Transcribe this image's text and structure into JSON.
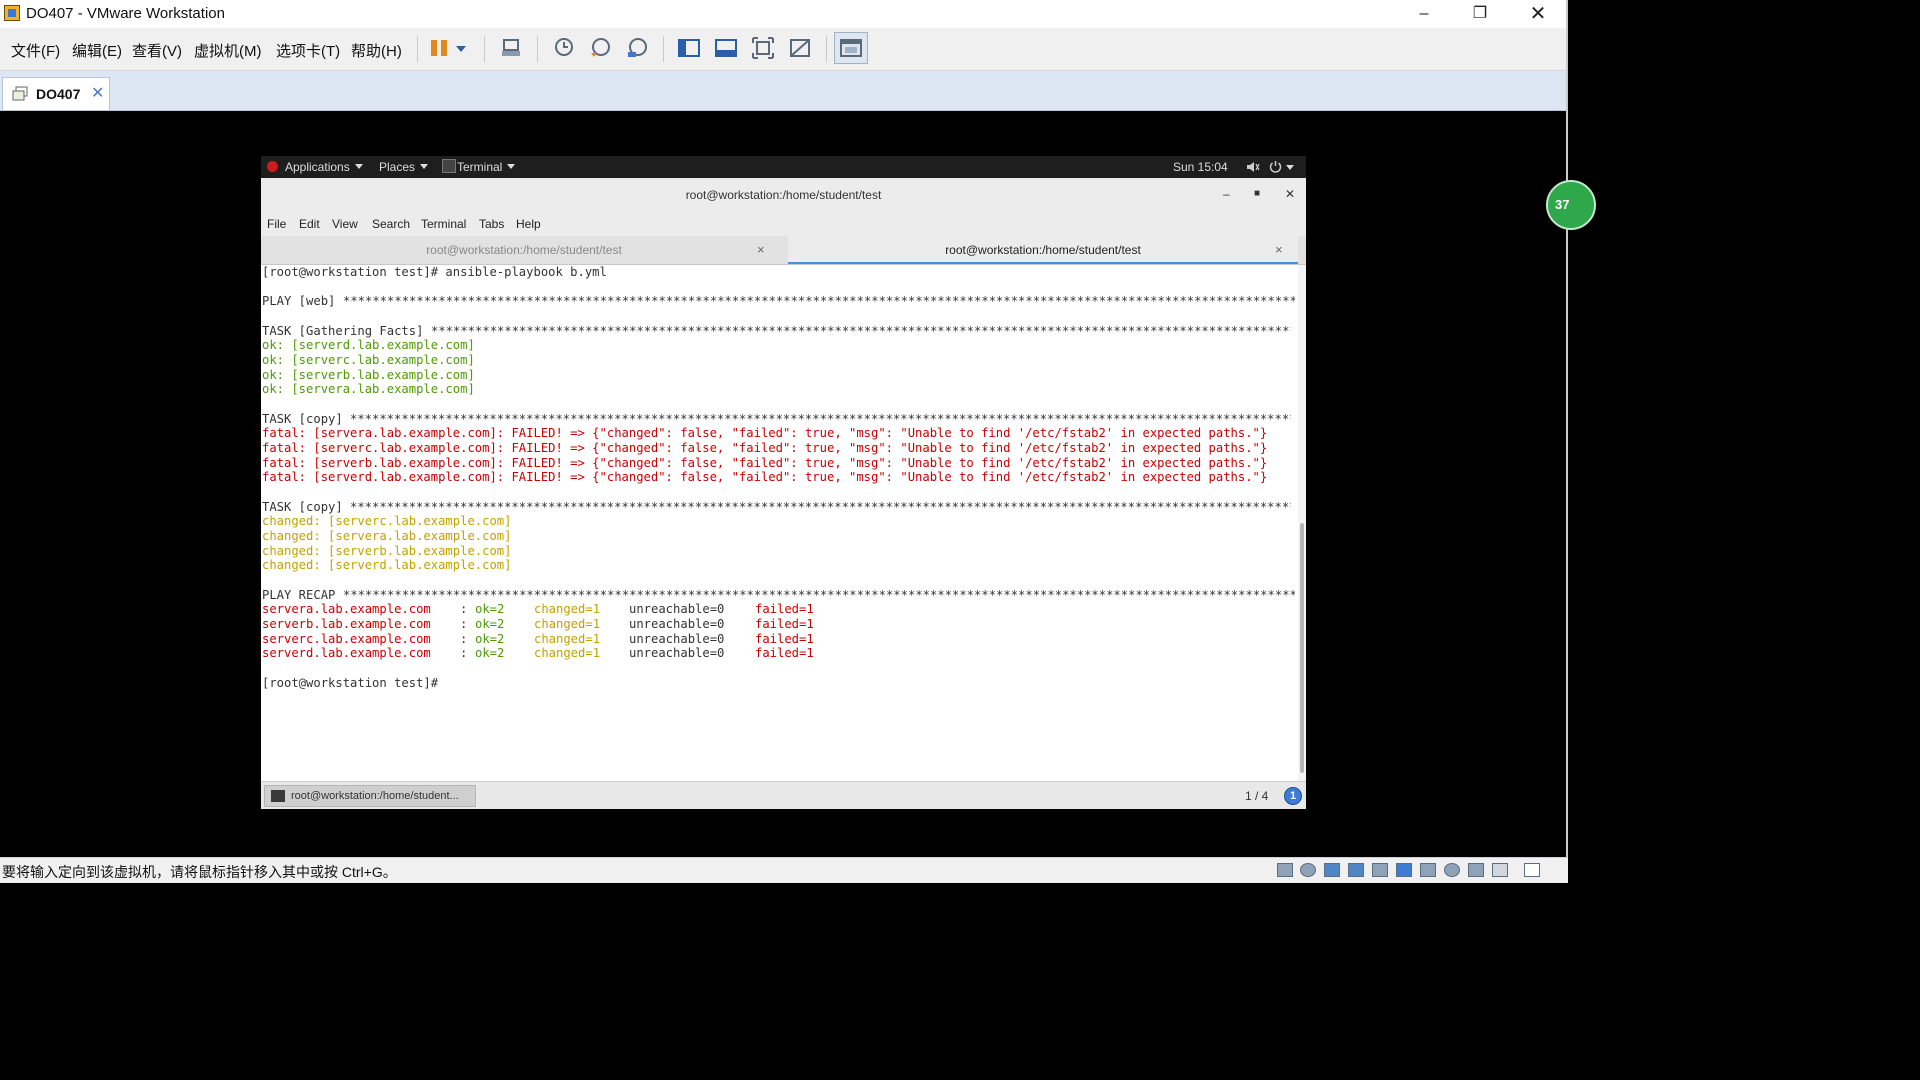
{
  "window": {
    "title": "DO407 - VMware Workstation"
  },
  "menu": [
    "文件(F)",
    "编辑(E)",
    "查看(V)",
    "虚拟机(M)",
    "选项卡(T)",
    "帮助(H)"
  ],
  "toolbar_icons": [
    "pause-icon",
    "dropdown-icon",
    "send-ctrl-alt-del-icon",
    "snapshot-icon",
    "revert-snapshot-icon",
    "snapshot-manager-icon",
    "show-library-icon",
    "thumbnail-bar-icon",
    "full-screen-icon",
    "unity-icon",
    "console-view-icon"
  ],
  "vm_tab": {
    "label": "DO407",
    "close": "✕"
  },
  "side_badge": "37",
  "guest": {
    "top_bar": {
      "applications": "Applications",
      "places": "Places",
      "terminal": "Terminal",
      "clock": "Sun 15:04"
    },
    "window_title": "root@workstation:/home/student/test",
    "menu": [
      "File",
      "Edit",
      "View",
      "Search",
      "Terminal",
      "Tabs",
      "Help"
    ],
    "tabs": [
      {
        "label": "root@workstation:/home/student/test",
        "close": "×"
      },
      {
        "label": "root@workstation:/home/student/test",
        "close": "×"
      }
    ],
    "terminal": {
      "command": "[root@workstation test]# ansible-playbook b.yml",
      "play_web": "PLAY [web] ",
      "task_facts": "TASK [Gathering Facts] ",
      "ok_lines": [
        "ok: [serverd.lab.example.com]",
        "ok: [serverc.lab.example.com]",
        "ok: [serverb.lab.example.com]",
        "ok: [servera.lab.example.com]"
      ],
      "task_copy1": "TASK [copy] ",
      "fatal_lines": [
        "fatal: [servera.lab.example.com]: FAILED! => {\"changed\": false, \"failed\": true, \"msg\": \"Unable to find '/etc/fstab2' in expected paths.\"}",
        "fatal: [serverc.lab.example.com]: FAILED! => {\"changed\": false, \"failed\": true, \"msg\": \"Unable to find '/etc/fstab2' in expected paths.\"}",
        "fatal: [serverb.lab.example.com]: FAILED! => {\"changed\": false, \"failed\": true, \"msg\": \"Unable to find '/etc/fstab2' in expected paths.\"}",
        "fatal: [serverd.lab.example.com]: FAILED! => {\"changed\": false, \"failed\": true, \"msg\": \"Unable to find '/etc/fstab2' in expected paths.\"}"
      ],
      "task_copy2": "TASK [copy] ",
      "changed_lines": [
        "changed: [serverc.lab.example.com]",
        "changed: [servera.lab.example.com]",
        "changed: [serverb.lab.example.com]",
        "changed: [serverd.lab.example.com]"
      ],
      "play_recap": "PLAY RECAP ",
      "recap": [
        {
          "host": "servera.lab.example.com",
          "ok": "ok=2",
          "changed": "changed=1",
          "unreachable": "unreachable=0",
          "failed": "failed=1"
        },
        {
          "host": "serverb.lab.example.com",
          "ok": "ok=2",
          "changed": "changed=1",
          "unreachable": "unreachable=0",
          "failed": "failed=1"
        },
        {
          "host": "serverc.lab.example.com",
          "ok": "ok=2",
          "changed": "changed=1",
          "unreachable": "unreachable=0",
          "failed": "failed=1"
        },
        {
          "host": "serverd.lab.example.com",
          "ok": "ok=2",
          "changed": "changed=1",
          "unreachable": "unreachable=0",
          "failed": "failed=1"
        }
      ],
      "prompt": "[root@workstation test]#"
    },
    "taskbar": {
      "item": "root@workstation:/home/student...",
      "workspace": "1 / 4",
      "notification": "1"
    }
  },
  "status_text": "要将输入定向到该虚拟机，请将鼠标指针移入其中或按 Ctrl+G。"
}
